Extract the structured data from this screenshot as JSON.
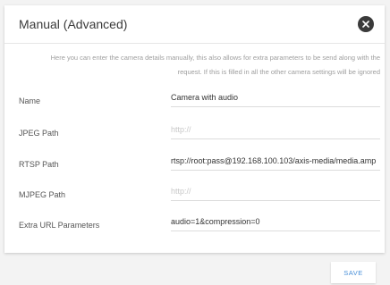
{
  "dialog": {
    "title": "Manual (Advanced)",
    "description_line1": "Here you can enter the camera details manually, this also allows for extra parameters to be send along with the",
    "description_line2": "request. If this is filled in all the other camera settings will be ignored"
  },
  "fields": [
    {
      "label": "Name",
      "value": "Camera with audio",
      "placeholder": ""
    },
    {
      "label": "JPEG Path",
      "value": "",
      "placeholder": "http://"
    },
    {
      "label": "RTSP Path",
      "value": "rtsp://root:pass@192.168.100.103/axis-media/media.amp",
      "placeholder": ""
    },
    {
      "label": "MJPEG Path",
      "value": "",
      "placeholder": "http://"
    },
    {
      "label": "Extra URL Parameters",
      "value": "audio=1&compression=0",
      "placeholder": ""
    }
  ],
  "footer": {
    "save_label": "SAVE"
  },
  "icons": {
    "close": "close-icon"
  },
  "colors": {
    "accent": "#4a90d9",
    "close_bg": "#3a3a3a",
    "page_bg": "#f3f3f3"
  }
}
